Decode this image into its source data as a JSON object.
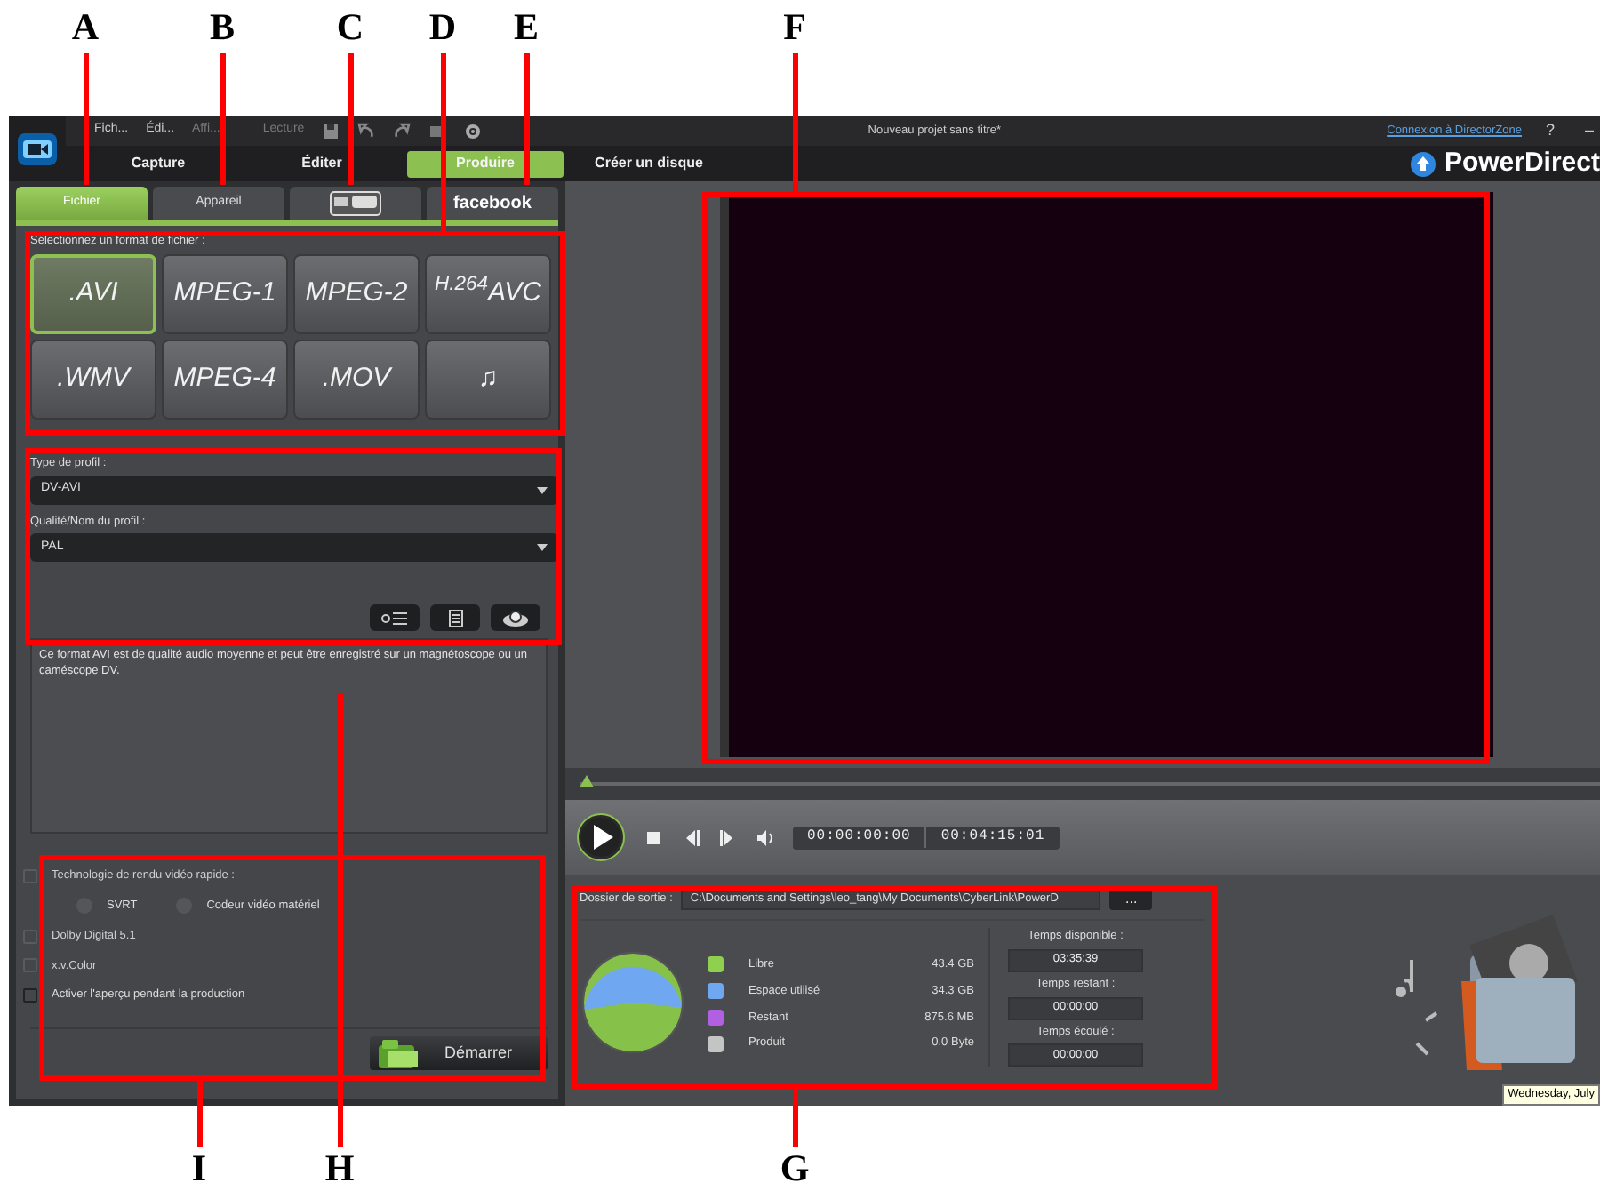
{
  "window": {
    "title": "Nouveau projet sans titre*",
    "link": "Connexion à DirectorZone",
    "help": "?",
    "minimize": "–"
  },
  "menu": [
    {
      "label": "Fich...",
      "disabled": false
    },
    {
      "label": "Édi...",
      "disabled": false
    },
    {
      "label": "Affi...",
      "disabled": true
    },
    {
      "label": "Lecture",
      "disabled": true
    }
  ],
  "modes": [
    {
      "label": "Capture",
      "selected": false
    },
    {
      "label": "Éditer",
      "selected": false
    },
    {
      "label": "Produire",
      "selected": true
    },
    {
      "label": "Créer un disque",
      "selected": false
    }
  ],
  "brand": "PowerDirect",
  "output_tabs": [
    {
      "kind": "text",
      "label": "Fichier",
      "selected": true
    },
    {
      "kind": "text",
      "label": "Appareil",
      "selected": false
    },
    {
      "kind": "youtube",
      "selected": false
    },
    {
      "kind": "facebook",
      "label": "facebook",
      "selected": false
    }
  ],
  "format_label": "Sélectionnez un format de fichier :",
  "formats": [
    {
      "label": ".AVI",
      "selected": true
    },
    {
      "label": "MPEG-1",
      "selected": false
    },
    {
      "label": "MPEG-2",
      "selected": false
    },
    {
      "label": "$^{H.264}$AVC",
      "selected": false
    },
    {
      "label": ".WMV",
      "selected": false
    },
    {
      "label": "MPEG-4",
      "selected": false
    },
    {
      "label": ".MOV",
      "selected": false
    },
    {
      "label": "♫",
      "selected": false
    }
  ],
  "profile": [
    {
      "label": "Type de profil :",
      "value": "DV-AVI"
    },
    {
      "label": "Qualité/Nom du profil :",
      "value": "PAL"
    }
  ],
  "description": "Ce format AVI est de qualité audio moyenne et peut être enregistré sur un magnétoscope ou un caméscope DV.",
  "options": [
    {
      "kind": "checkbox",
      "label": "Technologie de rendu vidéo rapide :",
      "checked": false,
      "disabled": true
    },
    {
      "kind": "radios",
      "items": [
        {
          "label": "SVRT",
          "selected": false
        },
        {
          "label": "Codeur vidéo matériel",
          "selected": false
        }
      ]
    },
    {
      "kind": "checkbox",
      "label": "Dolby Digital 5.1",
      "checked": false,
      "disabled": true
    },
    {
      "kind": "checkbox",
      "label": "x.v.Color",
      "checked": false,
      "disabled": true
    },
    {
      "kind": "checkbox",
      "label": "Activer l'aperçu pendant la production",
      "checked": false,
      "disabled": false
    }
  ],
  "start_button": "Démarrer",
  "player": {
    "position": "00:00:00:00",
    "duration": "00:04:15:01"
  },
  "output": {
    "label": "Dossier de sortie :",
    "path": "C:\\Documents and Settings\\leo_tang\\My Documents\\CyberLink\\PowerD",
    "browse": "...",
    "legend": [
      {
        "name": "Libre",
        "value": "43.4  GB",
        "color": "#8fd14f"
      },
      {
        "name": "Espace utilisé",
        "value": "34.3  GB",
        "color": "#6fa8f0"
      },
      {
        "name": "Restant",
        "value": "875.6  MB",
        "color": "#b060e0"
      },
      {
        "name": "Produit",
        "value": "0.0  Byte",
        "color": "#c4c4c4"
      }
    ],
    "times": [
      {
        "label": "Temps disponible :",
        "value": "03:35:39"
      },
      {
        "label": "Temps restant :",
        "value": "00:00:00"
      },
      {
        "label": "Temps écoulé :",
        "value": "00:00:00"
      }
    ]
  },
  "tooltip": "Wednesday, July",
  "annotations": [
    {
      "letter": "A"
    },
    {
      "letter": "B"
    },
    {
      "letter": "C"
    },
    {
      "letter": "D"
    },
    {
      "letter": "E"
    },
    {
      "letter": "F"
    },
    {
      "letter": "I"
    },
    {
      "letter": "H"
    },
    {
      "letter": "G"
    }
  ]
}
